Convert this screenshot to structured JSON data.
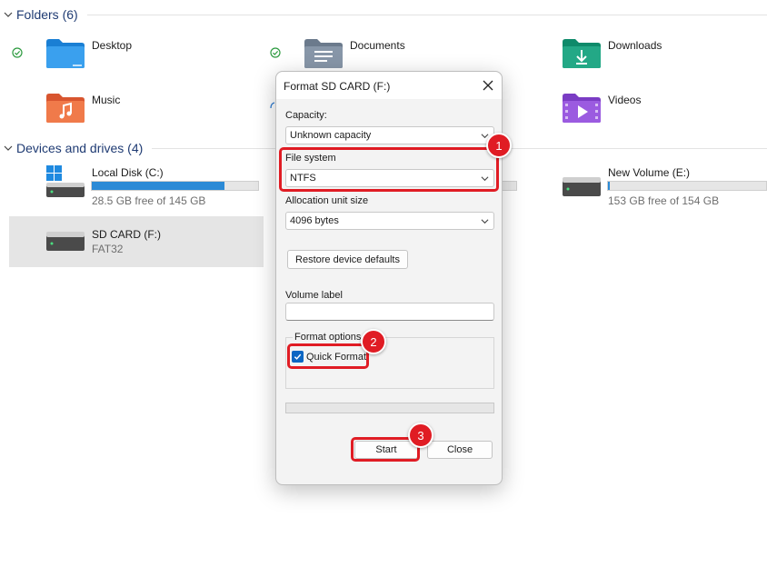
{
  "folders_section": {
    "title": "Folders (6)"
  },
  "folders": [
    {
      "name": "Desktop"
    },
    {
      "name": "Documents"
    },
    {
      "name": "Downloads"
    },
    {
      "name": "Music"
    },
    {
      "name": "Videos"
    }
  ],
  "drives_section": {
    "title": "Devices and drives (4)"
  },
  "drives": [
    {
      "name": "Local Disk (C:)",
      "detail": "28.5 GB free of 145 GB",
      "used_fraction": 0.8
    },
    {
      "name": "New Volume (E:)",
      "detail": "153 GB free of 154 GB",
      "used_fraction": 0.01
    },
    {
      "name": "SD CARD (F:)",
      "detail": "FAT32"
    }
  ],
  "dialog": {
    "title": "Format SD CARD (F:)",
    "capacity_label": "Capacity:",
    "capacity_value": "Unknown capacity",
    "filesystem_label": "File system",
    "filesystem_value": "NTFS",
    "allocation_label": "Allocation unit size",
    "allocation_value": "4096 bytes",
    "restore_button": "Restore device defaults",
    "volume_label": "Volume label",
    "volume_value": "",
    "format_options_label": "Format options",
    "quick_format_label": "Quick Format",
    "quick_format_checked": true,
    "start_button": "Start",
    "close_button": "Close"
  },
  "annotations": [
    {
      "number": "1"
    },
    {
      "number": "2"
    },
    {
      "number": "3"
    }
  ],
  "colors": {
    "accent": "#0b66c3",
    "highlight": "#e01c24",
    "drive_bar": "#2b8ad6"
  }
}
